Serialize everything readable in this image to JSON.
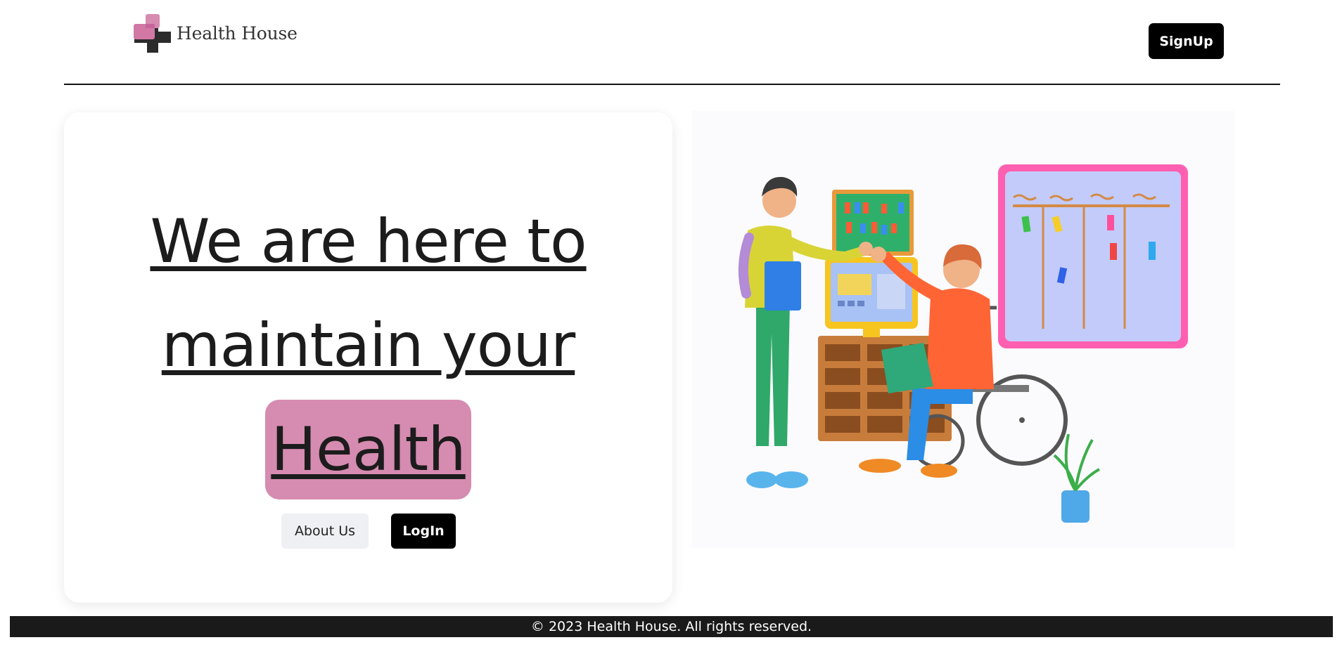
{
  "header": {
    "brand": "Health House",
    "signup_label": "SignUp"
  },
  "hero": {
    "headline_lines": [
      "We are here to",
      "maintain your"
    ],
    "highlight_word": "Health",
    "about_label": "About Us",
    "login_label": "LogIn"
  },
  "illustration": {
    "icon": "team-meeting-illustration"
  },
  "footer": {
    "text": "© 2023 Health House. All rights reserved."
  },
  "colors": {
    "accent_pink": "#d68bb0",
    "logo_dark": "#2b2b2b",
    "button_dark": "#000000",
    "footer_bg": "#1a1a1a"
  }
}
